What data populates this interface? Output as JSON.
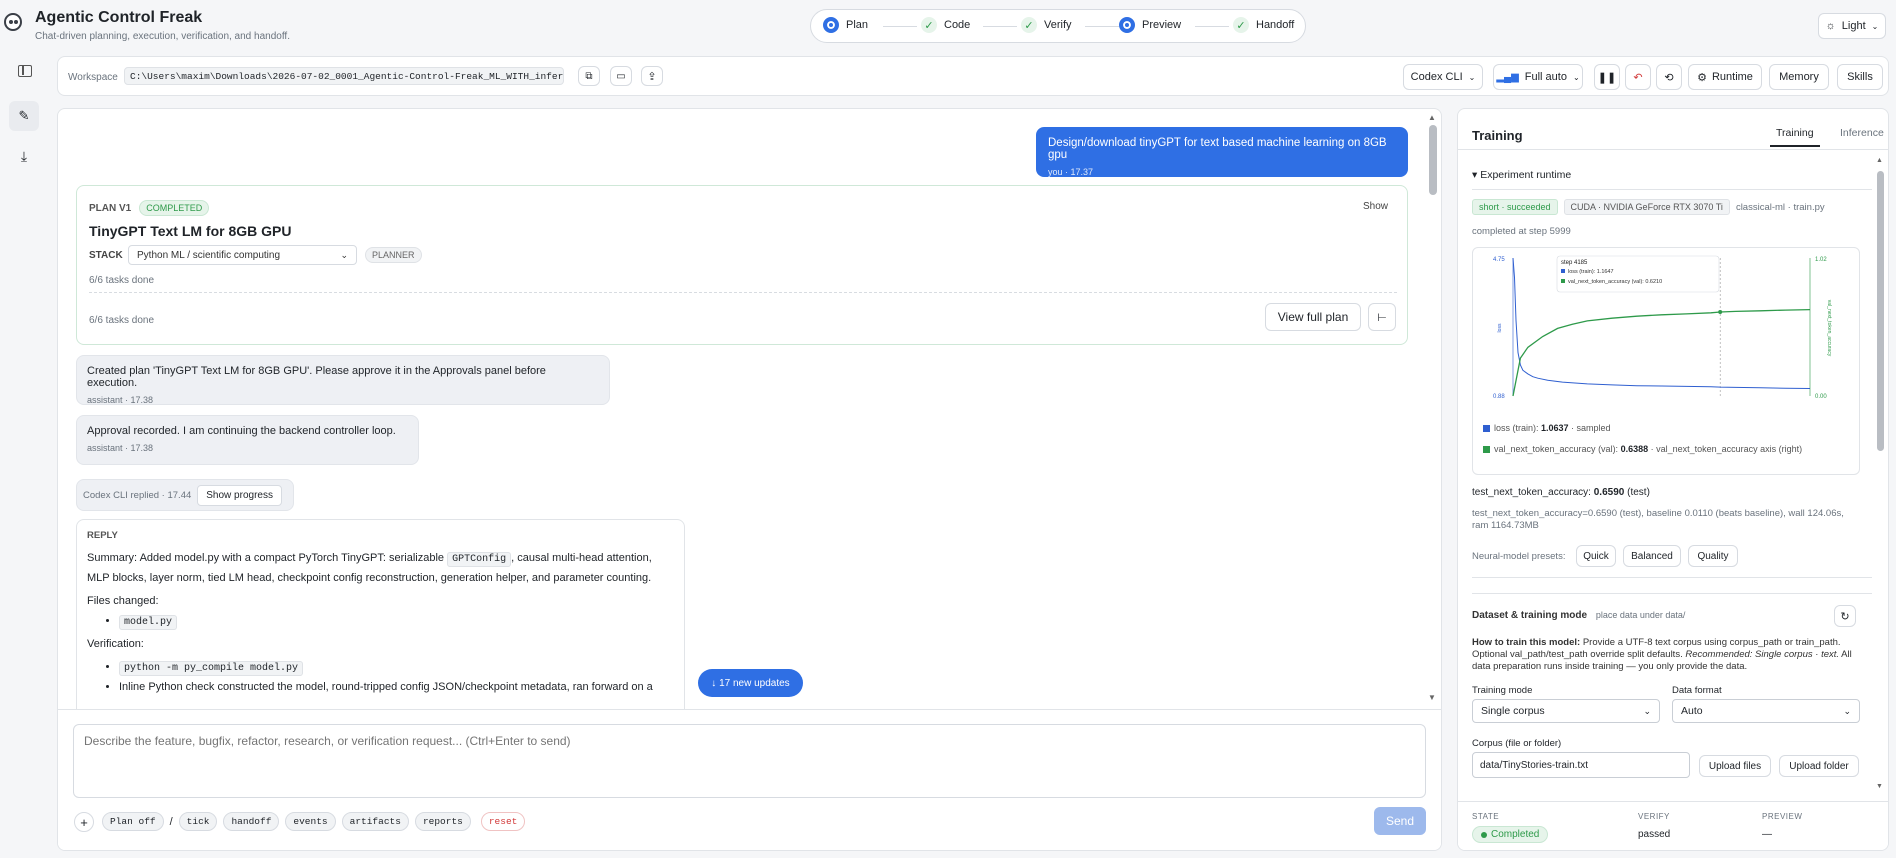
{
  "app": {
    "title": "Agentic Control Freak",
    "subtitle": "Chat-driven planning, execution, verification, and handoff.",
    "theme_label": "Light"
  },
  "stepper": [
    {
      "label": "Plan",
      "state": "active"
    },
    {
      "label": "Code",
      "state": "done"
    },
    {
      "label": "Verify",
      "state": "done"
    },
    {
      "label": "Preview",
      "state": "active"
    },
    {
      "label": "Handoff",
      "state": "done"
    }
  ],
  "toolbar": {
    "workspace_label": "Workspace",
    "workspace_path": "C:\\Users\\maxim\\Downloads\\2026-07-02_0001_Agentic-Control-Freak_ML_WITH_inference_...",
    "agent_select": "Codex CLI",
    "mode_select": "Full auto",
    "runtime_label": "Runtime",
    "memory_label": "Memory",
    "skills_label": "Skills"
  },
  "chat": {
    "user_message": "Design/download tinyGPT for text based machine learning on 8GB gpu",
    "user_meta": "you · 17.37",
    "plan": {
      "version": "PLAN V1",
      "status": "COMPLETED",
      "show_label": "Show",
      "title": "TinyGPT Text LM for 8GB GPU",
      "stack_label": "STACK",
      "stack_value": "Python ML / scientific computing",
      "planner_tag": "PLANNER",
      "tasks_done_top": "6/6 tasks done",
      "tasks_done_bottom": "6/6 tasks done",
      "view_full_plan": "View full plan"
    },
    "msg1": {
      "text": "Created plan 'TinyGPT Text LM for 8GB GPU'. Please approve it in the Approvals panel before execution.",
      "meta": "assistant · 17.38"
    },
    "msg2": {
      "text": "Approval recorded. I am continuing the backend controller loop.",
      "meta": "assistant · 17.38"
    },
    "codex": {
      "text": "Codex CLI replied · 17.44",
      "show_progress": "Show progress"
    },
    "reply": {
      "label": "REPLY",
      "summary_a": "Summary: Added model.py with a compact PyTorch TinyGPT: serializable",
      "summary_code": "GPTConfig",
      "summary_b": ", causal multi-head attention,",
      "summary_c": "MLP blocks, layer norm, tied LM head, checkpoint config reconstruction, generation helper, and parameter counting.",
      "files_changed": "Files changed:",
      "file1": "model.py",
      "verification": "Verification:",
      "verify_cmd": "python -m py_compile model.py",
      "verify_text": "Inline Python check constructed the model, round-tripped config JSON/checkpoint metadata, ran forward on a"
    },
    "new_updates": "↓ 17 new updates",
    "composer_placeholder": "Describe the feature, bugfix, refactor, research, or verification request... (Ctrl+Enter to send)",
    "chips": [
      "Plan off",
      "tick",
      "handoff",
      "events",
      "artifacts",
      "reports"
    ],
    "slash": "/",
    "reset": "reset",
    "send": "Send"
  },
  "panel": {
    "title": "Training",
    "tabs": [
      "Training",
      "Inference"
    ],
    "section_runtime": "▾ Experiment runtime",
    "badge_status": "short · succeeded",
    "badge_gpu": "CUDA · NVIDIA GeForce RTX 3070 Ti",
    "meta_file": "classical-ml · train.py",
    "completed_at": "completed at step 5999",
    "tooltip": {
      "step": "step 4185",
      "loss": "loss (train): 1.1647",
      "acc": "val_next_token_accuracy (val): 0.6210"
    },
    "legend_loss_a": "loss (train): ",
    "legend_loss_b": "1.0637",
    "legend_loss_c": " · sampled",
    "legend_acc_a": "val_next_token_accuracy (val): ",
    "legend_acc_b": "0.6388",
    "legend_acc_c": " · val_next_token_accuracy axis (right)",
    "test_acc_a": "test_next_token_accuracy: ",
    "test_acc_b": "0.6590",
    "test_acc_c": " (test)",
    "test_detail": "test_next_token_accuracy=0.6590 (test), baseline 0.0110 (beats baseline), wall 124.06s, ram 1164.73MB",
    "presets_label": "Neural-model presets:",
    "presets": [
      "Quick",
      "Balanced",
      "Quality"
    ],
    "dataset_title": "Dataset & training mode",
    "dataset_hint": "place data under data/",
    "howto_bold": "How to train this model:",
    "howto_a": " Provide a UTF-8 text corpus using corpus_path or train_path. Optional val_path/test_path override split defaults. ",
    "howto_italic": "Recommended: Single corpus · text.",
    "howto_b": " All data preparation runs inside training — you only provide the data.",
    "training_mode_label": "Training mode",
    "training_mode_value": "Single corpus",
    "data_format_label": "Data format",
    "data_format_value": "Auto",
    "corpus_label": "Corpus (file or folder)",
    "corpus_value": "data/TinyStories-train.txt",
    "upload_files": "Upload files",
    "upload_folder": "Upload folder",
    "footer": {
      "state_label": "STATE",
      "state_value": "Completed",
      "verify_label": "VERIFY",
      "verify_value": "passed",
      "preview_label": "PREVIEW",
      "preview_value": "—"
    }
  },
  "chart_data": {
    "type": "line",
    "y_left": {
      "top": "4.75",
      "bottom": "0.88",
      "label": "loss"
    },
    "y_right": {
      "top": "1.02",
      "bottom": "0.00",
      "label": "val_next_token_accuracy"
    },
    "series": [
      {
        "name": "loss (train)",
        "color": "#2f5fd0",
        "x": [
          0,
          30,
          60,
          100,
          150,
          200,
          300,
          400,
          500,
          700,
          1000,
          1500,
          2000,
          2500,
          3000,
          3500,
          4000,
          4185,
          4500,
          5000,
          5500,
          5999
        ],
        "values": [
          4.75,
          4.2,
          3.0,
          2.1,
          1.75,
          1.6,
          1.5,
          1.42,
          1.38,
          1.32,
          1.27,
          1.22,
          1.19,
          1.17,
          1.16,
          1.15,
          1.14,
          1.13,
          1.12,
          1.11,
          1.1,
          1.09
        ]
      },
      {
        "name": "val_next_token_accuracy (val)",
        "color": "#2e9a4a",
        "x": [
          0,
          150,
          300,
          600,
          900,
          1200,
          1500,
          2000,
          2500,
          3000,
          3500,
          4000,
          4185,
          4500,
          5000,
          5500,
          5999
        ],
        "values": [
          0.0,
          0.28,
          0.36,
          0.44,
          0.5,
          0.53,
          0.555,
          0.575,
          0.59,
          0.6,
          0.607,
          0.615,
          0.621,
          0.625,
          0.63,
          0.635,
          0.6388
        ]
      }
    ],
    "x_max": 5999,
    "y_left_range": [
      0.88,
      4.75
    ],
    "y_right_range": [
      0.0,
      1.02
    ],
    "cursor_x": 4185,
    "grid": false
  },
  "colors": {
    "accent": "#2f6fe4",
    "user_bubble": "#2f6fe4",
    "success": "#2e9a4a",
    "danger": "#d23a3a"
  }
}
